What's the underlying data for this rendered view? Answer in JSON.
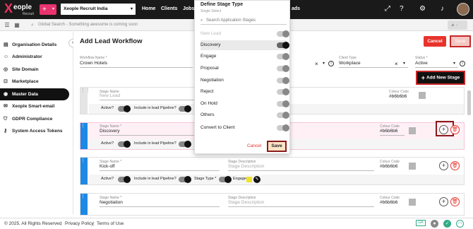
{
  "topbar": {
    "logo_text": "eople",
    "logo_sub": "Recruit",
    "org": "Xeople Recruit India",
    "nav": [
      "Home",
      "Clients",
      "Jobs",
      "ads"
    ]
  },
  "subbar": {
    "search_placeholder": "Global Search - Something awesome is coming soon",
    "add_label": "+ ·"
  },
  "sidebar": {
    "items": [
      {
        "label": "Organisation Details",
        "icon": "building-icon"
      },
      {
        "label": "Administrator",
        "icon": "person-icon"
      },
      {
        "label": "Site Domain",
        "icon": "globe-icon"
      },
      {
        "label": "Marketplace",
        "icon": "cart-icon"
      },
      {
        "label": "Master Data",
        "icon": "database-icon"
      },
      {
        "label": "Xeople Smart-email",
        "icon": "email-icon"
      },
      {
        "label": "GDPR Compliance",
        "icon": "shield-icon"
      },
      {
        "label": "System Access Tokens",
        "icon": "key-icon"
      }
    ]
  },
  "page": {
    "title": "Add Lead Workflow",
    "cancel": "Cancel",
    "save": "Save",
    "workflow_label": "Workflow Name *",
    "workflow_value": "Crown Hotels",
    "client_type_label": "Client Type",
    "client_type_value": "Workplace",
    "status_label": "Status *",
    "status_value": "Active",
    "add_stage": "Add New Stage"
  },
  "stages": [
    {
      "name_label": "Stage Name",
      "name": "New Lead",
      "desc_label": "",
      "desc": "",
      "colour_label": "Colour Code",
      "colour": "#b6b6b6"
    },
    {
      "name_label": "Stage Name *",
      "name": "Discovery",
      "desc_label": "",
      "desc": "",
      "colour_label": "Colour Code",
      "colour": "#b6b6b6"
    },
    {
      "name_label": "Stage Name *",
      "name": "Kick-off",
      "desc_label": "Stage Description",
      "desc": "Stage Description",
      "colour_label": "Colour Code",
      "colour": "#b6b6b6"
    },
    {
      "name_label": "Stage Name *",
      "name": "Negotiation",
      "desc_label": "Stage Description",
      "desc": "Stage Description",
      "colour_label": "Colour Code",
      "colour": "#b6b6b6"
    }
  ],
  "stage_labels": {
    "active": "Active?",
    "pipeline": "Include in lead Pipeline?",
    "stage_type": "Stage Type *",
    "engage": "Engage"
  },
  "popup": {
    "title": "Define Stage Type",
    "subtitle": "Single Select",
    "search_placeholder": "Search Application Stages",
    "items": [
      "New Lead",
      "Discovery",
      "Engage",
      "Proposal",
      "Negotiation",
      "Reject",
      "On Hold",
      "Others",
      "Convert to Client"
    ],
    "cancel": "Cancel",
    "save": "Save"
  },
  "footer": {
    "copyright": "© 2025. All Rights Reserved",
    "privacy": "Privacy Policy",
    "terms": "Terms of Use",
    "ga": "GA"
  },
  "colors": {
    "accent": "#e8336e",
    "danger": "#e8332c",
    "stage_blue": "#1e88e5"
  }
}
